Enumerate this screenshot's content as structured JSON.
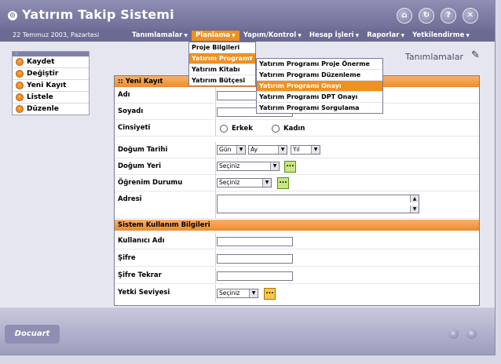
{
  "app": {
    "title": "Yatırım Takip Sistemi",
    "date": "22 Temmuz 2003, Pazartesi",
    "footer_logo": "Docuart"
  },
  "menu": [
    {
      "label": "Tanımlamalar"
    },
    {
      "label": "Planlama"
    },
    {
      "label": "Yapım/Kontrol"
    },
    {
      "label": "Hesap İşleri"
    },
    {
      "label": "Raporlar"
    },
    {
      "label": "Yetkilendirme"
    }
  ],
  "planlama_menu": [
    "Proje Bilgileri",
    "Yatırım Programı",
    "Yatırım Kitabı",
    "Yatırım Bütçesi"
  ],
  "yatirim_submenu": [
    "Yatırım Programı Proje Önerme",
    "Yatırım Programı Düzenleme",
    "Yatırım Programı Onayı",
    "Yatırım Programı DPT Onayı",
    "Yatırım Programı Sorgulama"
  ],
  "side_actions": [
    "Kaydet",
    "Değiştir",
    "Yeni Kayıt",
    "Listele",
    "Düzenle"
  ],
  "page_title": "Tanımlamalar",
  "form": {
    "section1": ":: Yeni Kayıt",
    "adi": "Adı",
    "soyadi": "Soyadı",
    "cinsiyet": "Cinsiyeti",
    "erkek": "Erkek",
    "kadin": "Kadın",
    "dogum_tarihi": "Doğum Tarihi",
    "gun": "Gün",
    "ay": "Ay",
    "yil": "Yıl",
    "dogum_yeri": "Doğum Yeri",
    "ogrenim": "Öğrenim Durumu",
    "adres": "Adresi",
    "seciniz": "Seçiniz",
    "more": "...",
    "section2": "Sistem Kullanım Bilgileri",
    "kullanici": "Kullanıcı Adı",
    "sifre": "Şifre",
    "sifre_tekrar": "Şifre Tekrar",
    "yetki": "Yetki Seviyesi"
  },
  "icons": {
    "logo": "circle-logo-icon",
    "pen": "pen-icon"
  }
}
